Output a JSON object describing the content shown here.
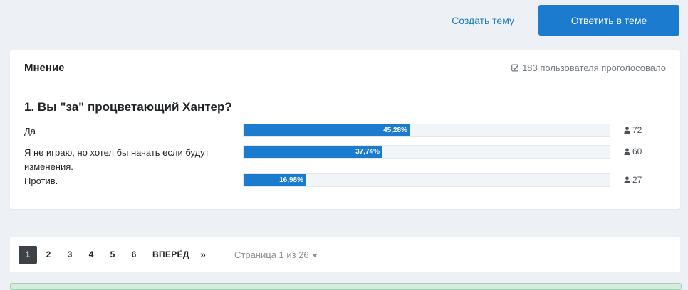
{
  "top_actions": {
    "create_topic": "Создать тему",
    "reply": "Ответить в теме"
  },
  "poll": {
    "title": "Мнение",
    "voters_text": "183 пользователя проголосовало",
    "question": "1. Вы \"за\" процветающий Хантер?",
    "options": [
      {
        "label": "Да",
        "percent_text": "45,28%",
        "percent": 45.28,
        "votes": "72"
      },
      {
        "label": "Я не играю, но хотел бы начать если будут изменения.",
        "percent_text": "37,74%",
        "percent": 37.74,
        "votes": "60"
      },
      {
        "label": "Против.",
        "percent_text": "16,98%",
        "percent": 16.98,
        "votes": "27"
      }
    ]
  },
  "pagination": {
    "pages": [
      "1",
      "2",
      "3",
      "4",
      "5",
      "6"
    ],
    "current": "1",
    "next": "ВПЕРЁД",
    "last": "»",
    "info": "Страница 1 из 26"
  },
  "icons": {
    "voters": "check-square-icon",
    "votes": "user-icon",
    "page_info": "caret-down-icon"
  },
  "colors": {
    "accent": "#1a7bcf",
    "background": "#edf0f4",
    "current_page": "#3d4247"
  }
}
